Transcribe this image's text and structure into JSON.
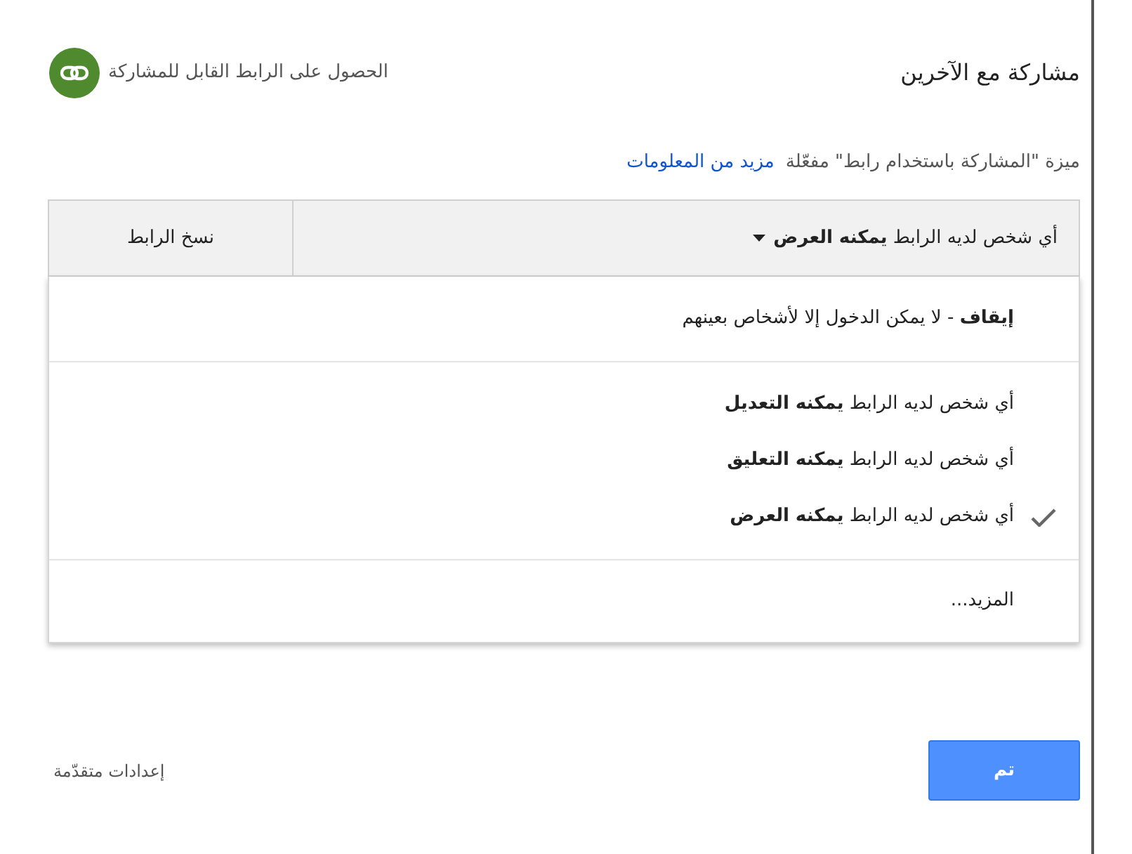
{
  "dialog": {
    "title": "مشاركة مع الآخرين",
    "get_link": "الحصول على الرابط القابل للمشاركة"
  },
  "status": {
    "text": "ميزة \"المشاركة باستخدام رابط\" مفعّلة",
    "link": "مزيد من المعلومات"
  },
  "access_dropdown": {
    "value": "أي شخص لديه الرابط **يمكنه العرض**",
    "copy_button": "نسخ الرابط"
  },
  "menu_groups": [
    [
      {
        "kind": "option",
        "text": "**إيقاف** - لا يمكن الدخول إلا لأشخاص بعينهم",
        "selected": false
      }
    ],
    [
      {
        "kind": "option",
        "text": "أي شخص لديه الرابط **يمكنه التعديل**",
        "selected": false
      },
      {
        "kind": "option",
        "text": "أي شخص لديه الرابط **يمكنه التعليق**",
        "selected": false
      },
      {
        "kind": "option",
        "text": "أي شخص لديه الرابط **يمكنه العرض**",
        "selected": true
      }
    ],
    [
      {
        "kind": "more",
        "text": "المزيد..."
      }
    ]
  ],
  "footer": {
    "advanced": "إعدادات متقدّمة",
    "done": "تم"
  }
}
